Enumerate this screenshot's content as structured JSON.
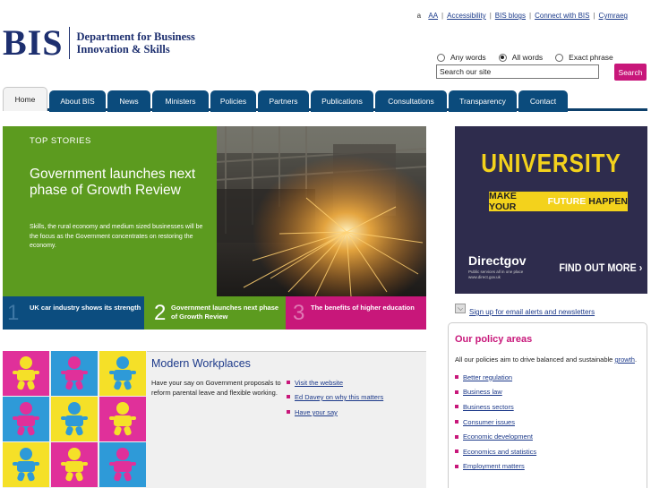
{
  "utility": {
    "text_size_small": "a",
    "text_size_large": "AA",
    "links": [
      "Accessibility",
      "BIS blogs",
      "Connect with BIS",
      "Cymraeg"
    ]
  },
  "logo": {
    "acronym": "BIS",
    "line1": "Department for Business",
    "line2": "Innovation & Skills"
  },
  "search": {
    "options": [
      {
        "label": "Any words",
        "selected": false
      },
      {
        "label": "All words",
        "selected": true
      },
      {
        "label": "Exact phrase",
        "selected": false
      }
    ],
    "placeholder": "Search our site",
    "button": "Search"
  },
  "nav": {
    "tabs": [
      "Home",
      "About BIS",
      "News",
      "Ministers",
      "Policies",
      "Partners",
      "Publications",
      "Consultations",
      "Transparency",
      "Contact"
    ],
    "active": "Home"
  },
  "feature": {
    "label": "TOP STORIES",
    "headline": "Government launches next phase of Growth Review",
    "summary": "Skills, the rural economy and medium sized businesses will be the focus as the Government concentrates on restoring the economy.",
    "stories": [
      {
        "num": "1",
        "text": "UK car industry shows its strength"
      },
      {
        "num": "2",
        "text": "Government launches next phase of Growth Review"
      },
      {
        "num": "3",
        "text": "The benefits of higher education"
      }
    ]
  },
  "modern_workplaces": {
    "title": "Modern Workplaces",
    "text": "Have your say on Government proposals to reform parental leave and flexible working.",
    "links": [
      "Visit the website",
      "Ed Davey on why this matters",
      "Have your say"
    ],
    "tile_colors": [
      "#e0309a",
      "#2e9ad8",
      "#f5e028",
      "#2e9ad8",
      "#f5e028",
      "#e0309a",
      "#f5e028",
      "#e0309a",
      "#2e9ad8"
    ],
    "figure_colors": [
      "#f5e028",
      "#e0309a",
      "#2e9ad8",
      "#e0309a",
      "#2e9ad8",
      "#f5e028",
      "#2e9ad8",
      "#f5e028",
      "#e0309a"
    ]
  },
  "promo": {
    "university": "UNIVERSITY",
    "make": "MAKE YOUR",
    "future": "FUTURE",
    "happen": "HAPPEN",
    "directgov": "Directgov",
    "sub": "Public services all in one place www.direct.gov.uk",
    "find_more": "FIND OUT MORE ›"
  },
  "signup": {
    "text": "Sign up for email alerts and newsletters"
  },
  "policy_areas": {
    "title": "Our policy areas",
    "intro_pre": "All our policies aim to drive balanced and sustainable ",
    "intro_link": "growth",
    "intro_post": ".",
    "items": [
      "Better regulation",
      "Business law",
      "Business sectors",
      "Consumer issues",
      "Economic development",
      "Economics and statistics",
      "Employment matters"
    ]
  },
  "colors": {
    "navy": "#0b4b7c",
    "green": "#5c9b1f",
    "magenta": "#c8177a",
    "logo_blue": "#1d2f6f"
  }
}
